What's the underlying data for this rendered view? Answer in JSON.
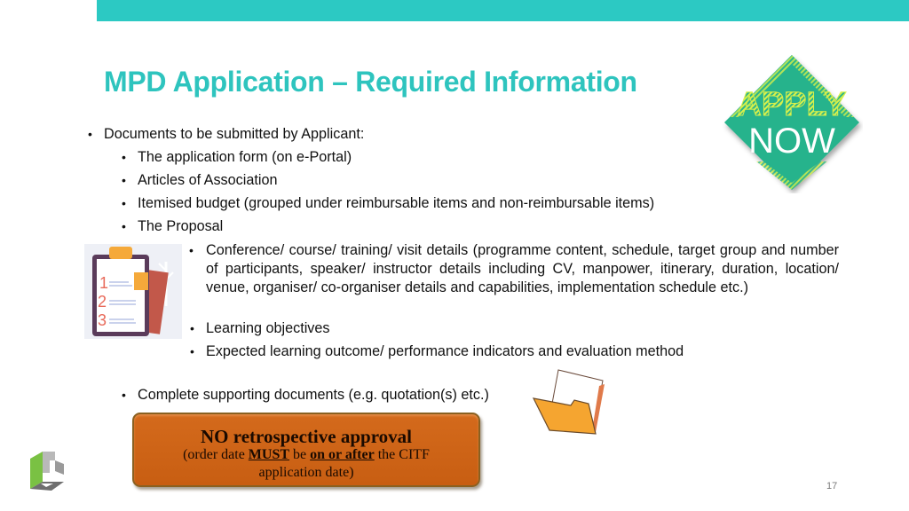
{
  "slide": {
    "title": "MPD Application – Required Information",
    "page_number": "17",
    "accent_color": "#2cc9c3"
  },
  "badge": {
    "line1": "APPLY",
    "line2": "NOW"
  },
  "bullets": {
    "main": "Documents to be submitted by Applicant:",
    "sub": [
      "The application form (on e-Portal)",
      "Articles of Association",
      "Itemised budget (grouped under reimbursable items and non-reimbursable items)",
      "The Proposal"
    ],
    "proposal_items": [
      "Conference/ course/ training/ visit details (programme content, schedule, target group and number of participants, speaker/ instructor details including CV, manpower, itinerary, duration, location/ venue, organiser/ co-organiser details and capabilities, implementation schedule etc.)",
      "Learning objectives",
      "Expected learning outcome/ performance indicators and evaluation method"
    ],
    "supporting": "Complete supporting documents (e.g. quotation(s) etc.)",
    "bullet_glyph": "•"
  },
  "clipboard": {
    "numbers": [
      "1",
      "2",
      "3"
    ]
  },
  "warning": {
    "title": "NO retrospective approval",
    "line_prefix": "(order date ",
    "must": "MUST",
    "be": " be ",
    "on_or_after": "on or after",
    "line_suffix": " the CITF",
    "line2": "application date)"
  }
}
